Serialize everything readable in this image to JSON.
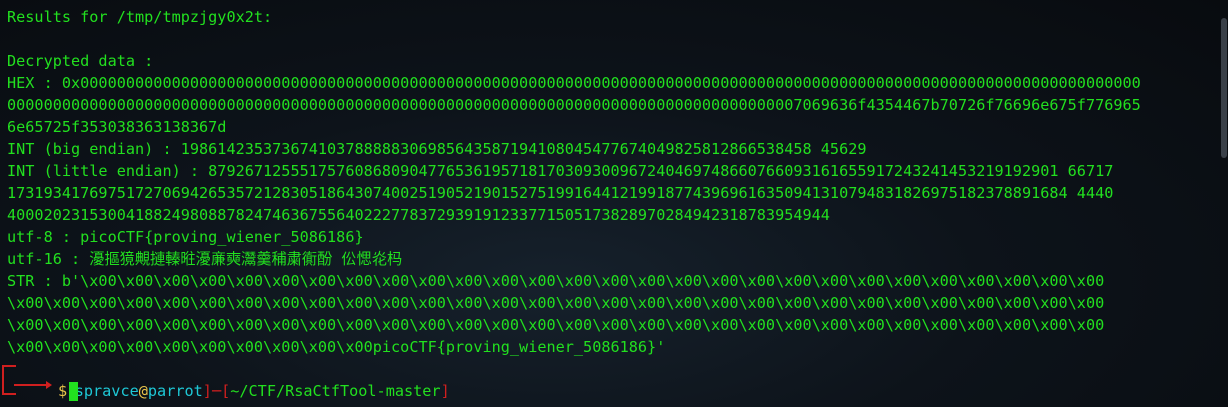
{
  "terminal": {
    "results_header": "Results for /tmp/tmpzjgy0x2t:",
    "decrypted_label": "Decrypted data :",
    "hex_lines": [
      "HEX : 0x00000000000000000000000000000000000000000000000000000000000000000000000000000000000000000000000000000000000000000000",
      "000000000000000000000000000000000000000000000000000000000000000000000000000000000000007069636f4354467b70726f76696e675f776965",
      "6e65725f353038363138367d"
    ],
    "int_big_endian": "INT (big endian) : 198614235373674103788888306985643587194108045477674049825812866538458 45629",
    "int_little_lines": [
      "INT (little endian) : 879267125551757608680904776536195718170309300967240469748660766093161655917243241453219192901 66717",
      "17319341769751727069426535721283051864307400251905219015275199164412199187743969616350941310794831826975182378891684 4440",
      "400020231530041882498088782474636755640222778372939191233771505173828970284942318783954944"
    ],
    "utf8_line": "utf-8 : picoCTF{proving_wiener_5086186}",
    "utf16_line": "utf-16 : 瀀摳獍覥摙轃暀瀀亷奭灊羹秿粛衠酚 伀愢炛杩",
    "str_lines": [
      "STR : b'\\x00\\x00\\x00\\x00\\x00\\x00\\x00\\x00\\x00\\x00\\x00\\x00\\x00\\x00\\x00\\x00\\x00\\x00\\x00\\x00\\x00\\x00\\x00\\x00\\x00\\x00\\x00\\x00",
      "\\x00\\x00\\x00\\x00\\x00\\x00\\x00\\x00\\x00\\x00\\x00\\x00\\x00\\x00\\x00\\x00\\x00\\x00\\x00\\x00\\x00\\x00\\x00\\x00\\x00\\x00\\x00\\x00\\x00\\x00",
      "\\x00\\x00\\x00\\x00\\x00\\x00\\x00\\x00\\x00\\x00\\x00\\x00\\x00\\x00\\x00\\x00\\x00\\x00\\x00\\x00\\x00\\x00\\x00\\x00\\x00\\x00\\x00\\x00\\x00\\x00",
      "\\x00\\x00\\x00\\x00\\x00\\x00\\x00\\x00\\x00\\x00picoCTF{proving_wiener_5086186}'"
    ],
    "prompt": {
      "open_bracket": "[",
      "user": "spravce",
      "at": "@",
      "host": "parrot",
      "close_bracket": "]",
      "dash": "─",
      "path_open": "[",
      "path": "~/CTF/RsaCtfTool-master",
      "path_close": "]",
      "symbol": "$"
    }
  },
  "colors": {
    "text_green": "#22e01f",
    "prompt_red": "#d01f1f",
    "host_cyan": "#1ec8d6",
    "background": "#0b0f14"
  }
}
